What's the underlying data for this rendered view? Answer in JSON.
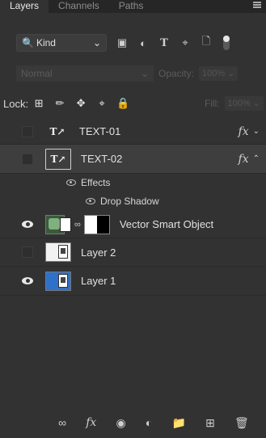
{
  "tabs": [
    "Layers",
    "Channels",
    "Paths"
  ],
  "filter": {
    "kind_label": "Kind"
  },
  "blend": {
    "mode": "Normal",
    "opacity_label": "Opacity:",
    "opacity_value": "100%"
  },
  "lock": {
    "label": "Lock:",
    "fill_label": "Fill:",
    "fill_value": "100%"
  },
  "layers": [
    {
      "name": "TEXT-01",
      "fx": "fx"
    },
    {
      "name": "TEXT-02",
      "fx": "fx"
    },
    {
      "name": "Vector Smart Object"
    },
    {
      "name": "Layer 2"
    },
    {
      "name": "Layer 1"
    }
  ],
  "effects": {
    "label": "Effects",
    "drop_shadow": "Drop Shadow"
  },
  "bottom": {
    "fx_label": "fx"
  },
  "colors": {
    "panel": "#323232",
    "selected": "#3e3e3e",
    "layer1_thumb": "#2f70c8"
  }
}
